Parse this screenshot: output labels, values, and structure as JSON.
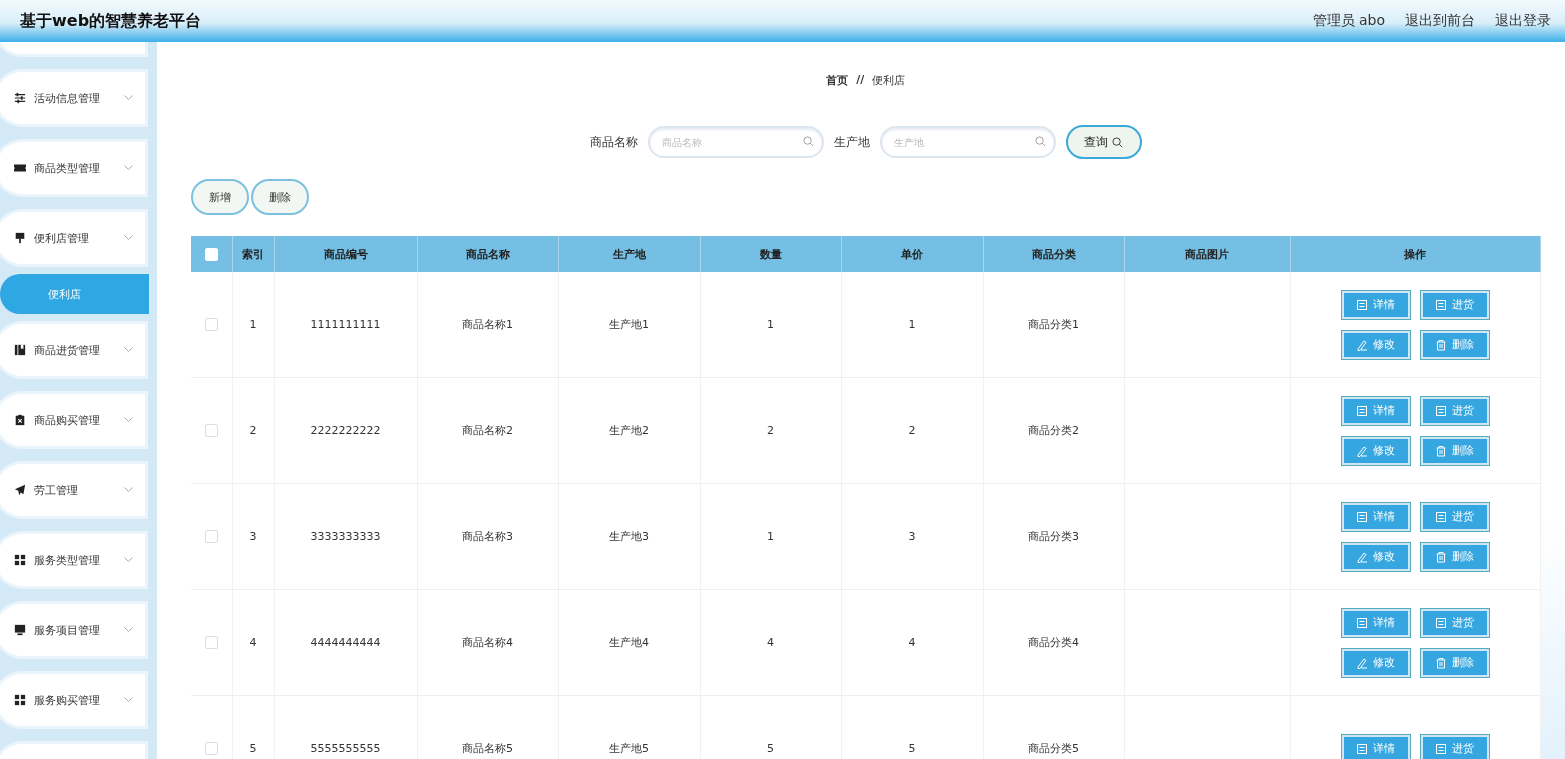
{
  "header": {
    "title": "基于web的智慧养老平台",
    "user": "管理员 abo",
    "links": [
      "退出到前台",
      "退出登录"
    ]
  },
  "sidebar": {
    "items": [
      {
        "label": "活动信息管理",
        "selected": false
      },
      {
        "label": "商品类型管理",
        "selected": false
      },
      {
        "label": "便利店管理",
        "selected": false,
        "children": [
          {
            "label": "便利店",
            "selected": true
          }
        ]
      },
      {
        "label": "商品进货管理",
        "selected": false
      },
      {
        "label": "商品购买管理",
        "selected": false
      },
      {
        "label": "劳工管理",
        "selected": false
      },
      {
        "label": "服务类型管理",
        "selected": false
      },
      {
        "label": "服务项目管理",
        "selected": false
      },
      {
        "label": "服务购买管理",
        "selected": false
      }
    ]
  },
  "breadcrumb": [
    "首页",
    "//",
    "便利店"
  ],
  "search": {
    "fields": [
      {
        "label": "商品名称",
        "placeholder": "商品名称"
      },
      {
        "label": "生产地",
        "placeholder": "生产地"
      }
    ],
    "button": "查询"
  },
  "toolbar": [
    "新增",
    "删除"
  ],
  "table": {
    "select_all": false,
    "columns": [
      "索引",
      "商品编号",
      "商品名称",
      "生产地",
      "数量",
      "单价",
      "商品分类",
      "商品图片",
      "操作"
    ],
    "rows": [
      {
        "checked": false,
        "cells": [
          "1",
          "1111111111",
          "商品名称1",
          "生产地1",
          "1",
          "1",
          "商品分类1"
        ],
        "actions": [
          {
            "kind": "detail",
            "label": "详情"
          },
          {
            "kind": "stock",
            "label": "进货"
          },
          {
            "kind": "edit",
            "label": "修改"
          },
          {
            "kind": "delete",
            "label": "删除"
          }
        ]
      },
      {
        "checked": false,
        "cells": [
          "2",
          "2222222222",
          "商品名称2",
          "生产地2",
          "2",
          "2",
          "商品分类2"
        ],
        "actions": [
          {
            "kind": "detail",
            "label": "详情"
          },
          {
            "kind": "stock",
            "label": "进货"
          },
          {
            "kind": "edit",
            "label": "修改"
          },
          {
            "kind": "delete",
            "label": "删除"
          }
        ]
      },
      {
        "checked": false,
        "cells": [
          "3",
          "3333333333",
          "商品名称3",
          "生产地3",
          "1",
          "3",
          "商品分类3"
        ],
        "actions": [
          {
            "kind": "detail",
            "label": "详情"
          },
          {
            "kind": "stock",
            "label": "进货"
          },
          {
            "kind": "edit",
            "label": "修改"
          },
          {
            "kind": "delete",
            "label": "删除"
          }
        ]
      },
      {
        "checked": false,
        "cells": [
          "4",
          "4444444444",
          "商品名称4",
          "生产地4",
          "4",
          "4",
          "商品分类4"
        ],
        "actions": [
          {
            "kind": "detail",
            "label": "详情"
          },
          {
            "kind": "stock",
            "label": "进货"
          },
          {
            "kind": "edit",
            "label": "修改"
          },
          {
            "kind": "delete",
            "label": "删除"
          }
        ]
      },
      {
        "checked": false,
        "cells": [
          "5",
          "5555555555",
          "商品名称5",
          "生产地5",
          "5",
          "5",
          "商品分类5"
        ],
        "actions": [
          {
            "kind": "detail",
            "label": "详情"
          },
          {
            "kind": "stock",
            "label": "进货"
          }
        ]
      }
    ]
  }
}
